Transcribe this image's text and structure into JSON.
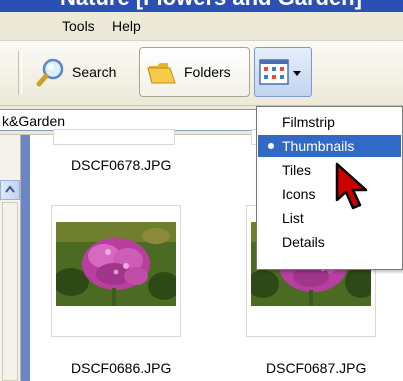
{
  "window": {
    "title_fragment": "Nature [Flowers and Garden]"
  },
  "menubar": {
    "items": [
      "Tools",
      "Help"
    ]
  },
  "toolbar": {
    "search_label": "Search",
    "folders_label": "Folders",
    "views_icon": "views-grid-icon"
  },
  "address": {
    "value_fragment": "k&Garden"
  },
  "thumbnails": [
    {
      "caption": "DSCF0678.JPG"
    },
    {
      "caption": "DSCF0686.JPG"
    },
    {
      "caption": "DSCF0687.JPG"
    }
  ],
  "views_menu": {
    "items": [
      "Filmstrip",
      "Thumbnails",
      "Tiles",
      "Icons",
      "List",
      "Details"
    ],
    "selected": "Thumbnails"
  },
  "colors": {
    "selection": "#316ac5",
    "cursor": "#cc0000",
    "toolbar_bg": "#ece9d8"
  }
}
